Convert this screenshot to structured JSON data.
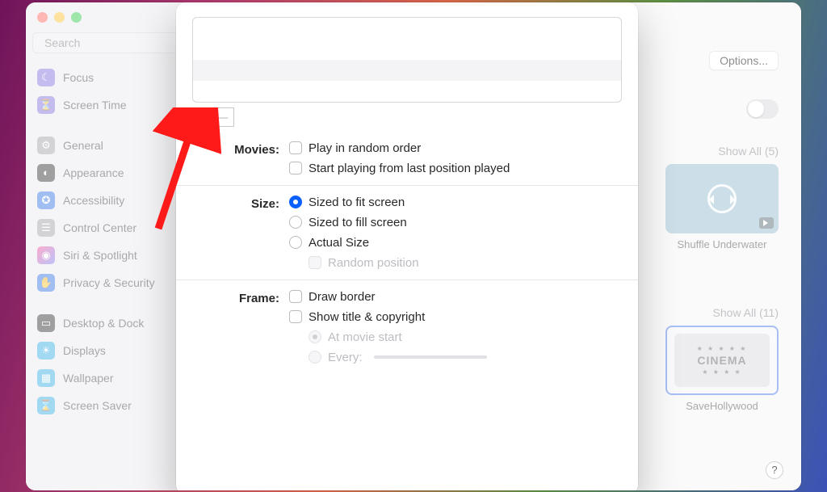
{
  "window": {
    "title": "Screen Saver",
    "search_placeholder": "Search"
  },
  "sidebar": {
    "groups": [
      {
        "items": [
          {
            "label": "Focus"
          },
          {
            "label": "Screen Time"
          }
        ]
      },
      {
        "items": [
          {
            "label": "General"
          },
          {
            "label": "Appearance"
          },
          {
            "label": "Accessibility"
          },
          {
            "label": "Control Center"
          },
          {
            "label": "Siri & Spotlight"
          },
          {
            "label": "Privacy & Security"
          }
        ]
      },
      {
        "items": [
          {
            "label": "Desktop & Dock"
          },
          {
            "label": "Displays"
          },
          {
            "label": "Wallpaper"
          },
          {
            "label": "Screen Saver"
          }
        ]
      }
    ]
  },
  "main": {
    "options_button": "Options...",
    "show_all_1": "Show All (5)",
    "show_all_2": "Show All (11)",
    "collections": [
      {
        "label": "Shuffle Underwater"
      },
      {
        "label": "SaveHollywood",
        "ticket": "CINEMA"
      }
    ]
  },
  "sheet": {
    "labels": {
      "movies": "Movies:",
      "size": "Size:",
      "frame": "Frame:"
    },
    "movies": {
      "play_random": "Play in random order",
      "start_last": "Start playing from last position played"
    },
    "size": {
      "fit": "Sized to fit screen",
      "fill": "Sized to fill screen",
      "actual": "Actual Size",
      "random_pos": "Random position"
    },
    "frame": {
      "border": "Draw border",
      "title": "Show title & copyright",
      "at_start": "At movie start",
      "every": "Every:"
    }
  }
}
